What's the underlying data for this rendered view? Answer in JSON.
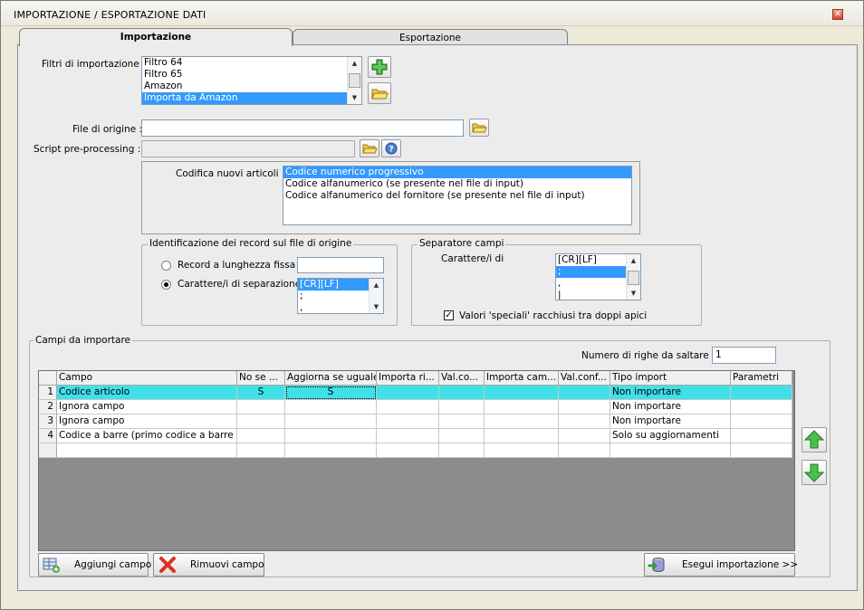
{
  "window": {
    "title": "IMPORTAZIONE / ESPORTAZIONE DATI",
    "close_glyph": "✕"
  },
  "tabs": [
    {
      "label": "Importazione",
      "active": true
    },
    {
      "label": "Esportazione",
      "active": false
    }
  ],
  "filters": {
    "label": "Filtri di importazione :",
    "items": [
      "Filtro 64",
      "Filtro 65",
      "Amazon",
      "Importa da Amazon"
    ],
    "selected": "Importa da Amazon",
    "add_icon": "plus-icon",
    "open_icon": "folder-icon"
  },
  "source_file": {
    "label": "File di origine :",
    "value": "",
    "browse_icon": "folder-icon"
  },
  "preprocessing": {
    "label": "Script pre-processing :",
    "value": "",
    "browse_icon": "folder-icon",
    "help_icon": "help-icon"
  },
  "codifica": {
    "label": "Codifica nuovi articoli :",
    "options": [
      "Codice numerico progressivo",
      "Codice alfanumerico (se presente nel file di input)",
      "Codice alfanumerico del fornitore (se presente nel file di input)"
    ],
    "selected": "Codice numerico progressivo"
  },
  "record_id": {
    "group_label": "Identificazione dei record sul file di origine",
    "option_fixed": "Record a lunghezza fissa",
    "option_sep": "Carattere/i di separazione",
    "selected": "Carattere/i di separazione",
    "fixed_value": "",
    "sep_items": [
      "[CR][LF]",
      ";",
      ","
    ],
    "sep_selected": "[CR][LF]"
  },
  "separator": {
    "group_label": "Separatore campi",
    "label": "Carattere/i di",
    "items": [
      "[CR][LF]",
      ";",
      ",",
      "|"
    ],
    "selected": ";",
    "quotes_label": "Valori 'speciali' racchiusi tra doppi apici",
    "quotes_checked": true
  },
  "fields": {
    "group_label": "Campi da importare",
    "skip_label": "Numero di righe da saltare  :",
    "skip_value": "1",
    "columns": [
      "Campo",
      "No se ...",
      "Aggiorna se uguale",
      "Importa ri...",
      "Val.co...",
      "Importa cam...",
      "Val.conf...",
      "Tipo import",
      "Parametri"
    ],
    "rows": [
      {
        "n": "1",
        "campo": "Codice articolo",
        "no_se": "S",
        "aggiorna": "S",
        "importa_ri": "",
        "val_co": "",
        "importa_cam": "",
        "val_conf": "",
        "tipo": "Non importare",
        "parametri": ""
      },
      {
        "n": "2",
        "campo": "Ignora campo",
        "no_se": "",
        "aggiorna": "",
        "importa_ri": "",
        "val_co": "",
        "importa_cam": "",
        "val_conf": "",
        "tipo": "Non importare",
        "parametri": ""
      },
      {
        "n": "3",
        "campo": "Ignora campo",
        "no_se": "",
        "aggiorna": "",
        "importa_ri": "",
        "val_co": "",
        "importa_cam": "",
        "val_conf": "",
        "tipo": "Non importare",
        "parametri": ""
      },
      {
        "n": "4",
        "campo": "Codice a barre (primo codice a barre i...",
        "no_se": "",
        "aggiorna": "",
        "importa_ri": "",
        "val_co": "",
        "importa_cam": "",
        "val_conf": "",
        "tipo": "Solo su aggiornamenti",
        "parametri": ""
      }
    ]
  },
  "buttons": {
    "add_field": "Aggiungi campo",
    "remove_field": "Rimuovi campo",
    "run_import": "Esegui importazione >>",
    "up_icon": "arrow-up-icon",
    "down_icon": "arrow-down-icon"
  },
  "colors": {
    "selection": "#3399ff",
    "current_row": "#40e0e8",
    "green_icon": "#3aa63a"
  }
}
